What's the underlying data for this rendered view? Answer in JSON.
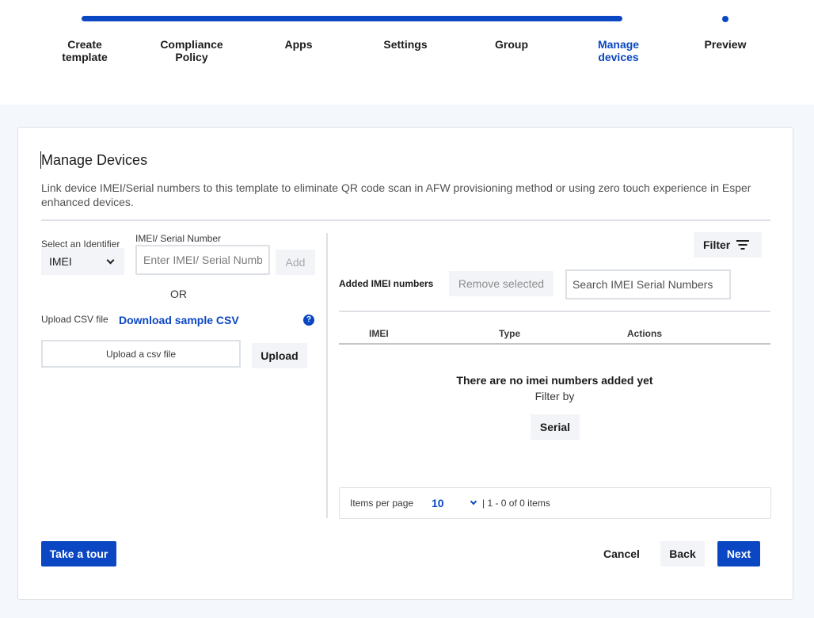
{
  "stepper": {
    "steps": [
      {
        "line1": "Create",
        "line2": "template",
        "active": false
      },
      {
        "line1": "Compliance",
        "line2": "Policy",
        "active": false
      },
      {
        "line1": "Apps",
        "line2": "",
        "active": false
      },
      {
        "line1": "Settings",
        "line2": "",
        "active": false
      },
      {
        "line1": "Group",
        "line2": "",
        "active": false
      },
      {
        "line1": "Manage",
        "line2": "devices",
        "active": true
      },
      {
        "line1": "Preview",
        "line2": "",
        "active": false
      }
    ]
  },
  "page": {
    "title": "Manage Devices",
    "description": "Link device IMEI/Serial numbers to this template to eliminate QR code scan in AFW provisioning method or using zero touch experience in Esper enhanced devices."
  },
  "identifier": {
    "label": "Select an Identifier",
    "selected": "IMEI",
    "options": [
      "IMEI"
    ]
  },
  "imei_input": {
    "label": "IMEI/ Serial Number",
    "placeholder": "Enter IMEI/ Serial Number",
    "value": "",
    "add_label": "Add"
  },
  "or_text": "OR",
  "csv": {
    "label": "Upload CSV file",
    "download_link": "Download sample CSV",
    "help_glyph": "?",
    "field_text": "Upload a csv file",
    "upload_label": "Upload"
  },
  "right_panel": {
    "filter_label": "Filter",
    "added_label": "Added IMEI numbers",
    "remove_label": "Remove selected",
    "search_placeholder": "Search IMEI Serial Numbers",
    "columns": [
      "IMEI",
      "Type",
      "Actions"
    ],
    "empty_title": "There are no imei numbers added yet",
    "empty_sub": "Filter by",
    "serial_label": "Serial"
  },
  "pagination": {
    "items_per_page_label": "Items per page",
    "items_per_page_value": "10",
    "range_text": "| 1 - 0 of 0 items"
  },
  "footer": {
    "tour_label": "Take a tour",
    "cancel_label": "Cancel",
    "back_label": "Back",
    "next_label": "Next"
  },
  "colors": {
    "accent": "#0b47c2",
    "background": "#f4f7fb",
    "button_bg": "#f2f4f8"
  },
  "icons": {
    "filter": "filter-lines-icon",
    "help": "help-circle-icon",
    "chevron": "chevron-down-icon"
  }
}
